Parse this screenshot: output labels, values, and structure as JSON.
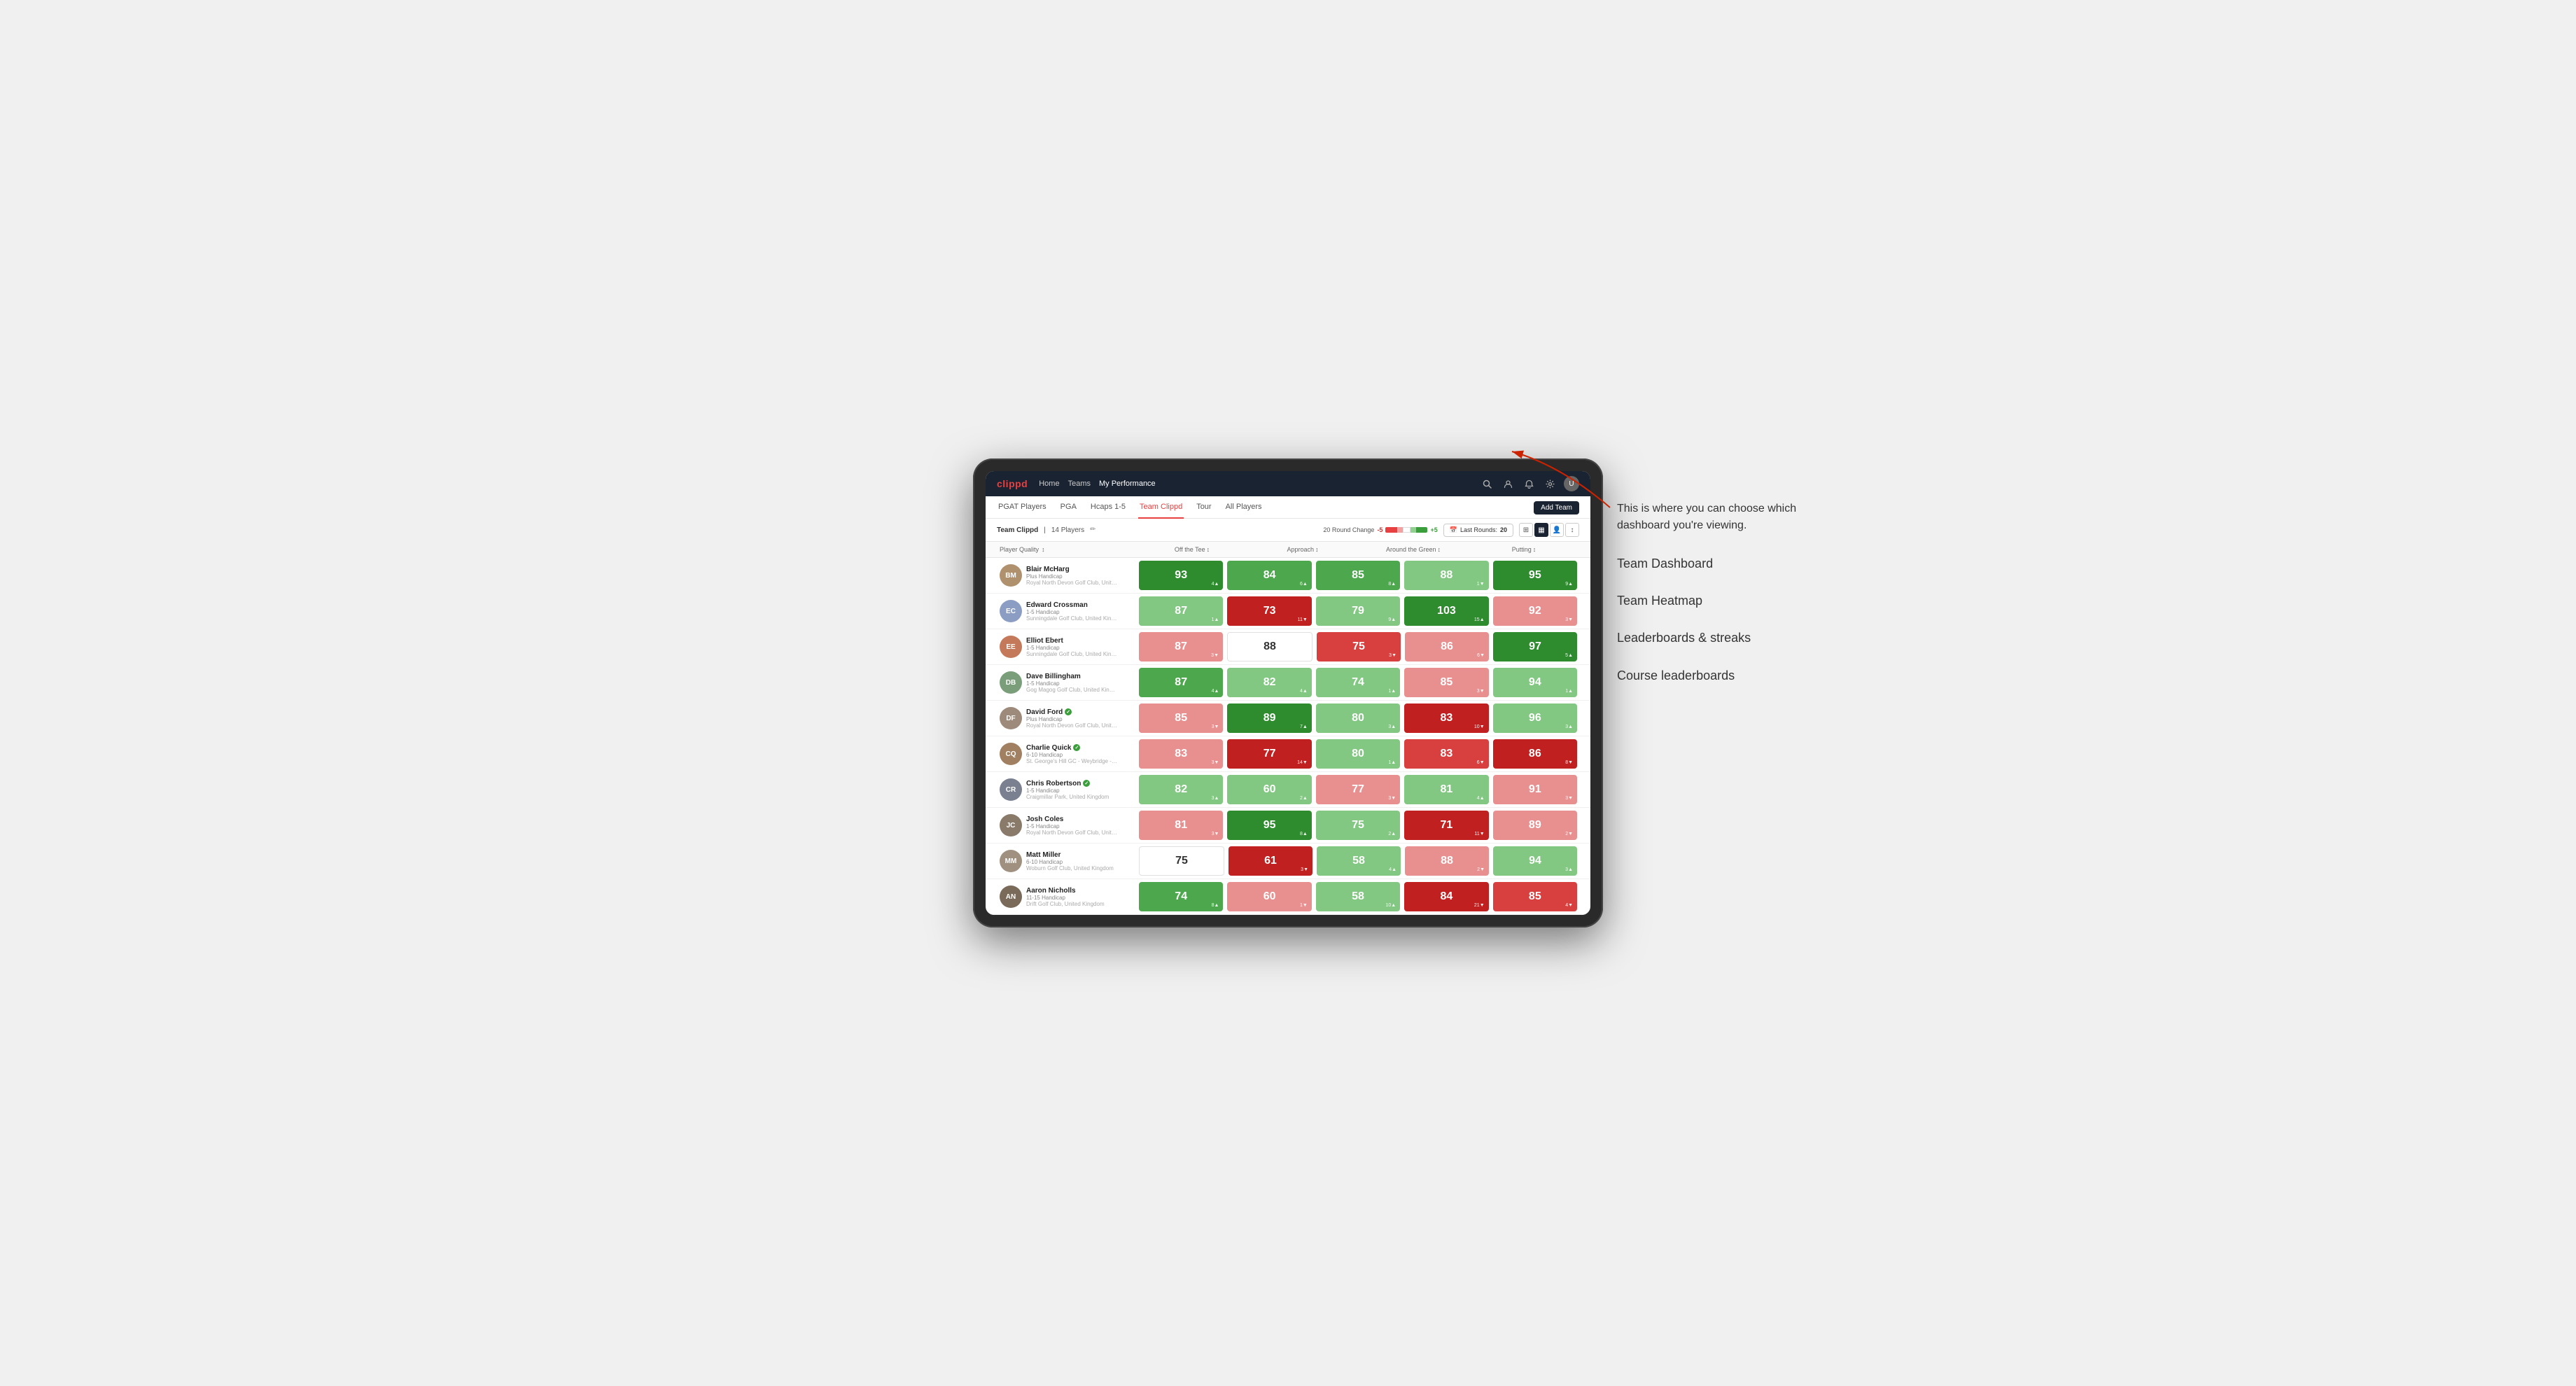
{
  "brand": "clippd",
  "navbar": {
    "links": [
      {
        "label": "Home",
        "active": false
      },
      {
        "label": "Teams",
        "active": false
      },
      {
        "label": "My Performance",
        "active": true
      }
    ],
    "icons": [
      "search",
      "person",
      "bell",
      "settings",
      "user-avatar"
    ]
  },
  "subnav": {
    "tabs": [
      {
        "label": "PGAT Players",
        "active": false
      },
      {
        "label": "PGA",
        "active": false
      },
      {
        "label": "Hcaps 1-5",
        "active": false
      },
      {
        "label": "Team Clippd",
        "active": true
      },
      {
        "label": "Tour",
        "active": false
      },
      {
        "label": "All Players",
        "active": false
      }
    ],
    "add_team_label": "Add Team"
  },
  "team_header": {
    "name": "Team Clippd",
    "separator": "|",
    "count": "14 Players",
    "round_change_label": "20 Round Change",
    "range_min": "-5",
    "range_max": "+5",
    "last_rounds_label": "Last Rounds:",
    "last_rounds_value": "20"
  },
  "table": {
    "columns": [
      {
        "label": "Player Quality",
        "key": "quality",
        "sortable": true
      },
      {
        "label": "Off the Tee",
        "key": "tee",
        "sortable": true
      },
      {
        "label": "Approach",
        "key": "approach",
        "sortable": true
      },
      {
        "label": "Around the Green",
        "key": "around",
        "sortable": true
      },
      {
        "label": "Putting",
        "key": "putting",
        "sortable": true
      }
    ],
    "rows": [
      {
        "name": "Blair McHarg",
        "handicap": "Plus Handicap",
        "club": "Royal North Devon Golf Club, United Kingdom",
        "avatar_color": "avatar-1",
        "initials": "BM",
        "quality": {
          "value": 93,
          "change": 4,
          "dir": "up",
          "color": "green-dark"
        },
        "tee": {
          "value": 84,
          "change": 6,
          "dir": "up",
          "color": "green-med"
        },
        "approach": {
          "value": 85,
          "change": 8,
          "dir": "up",
          "color": "green-med"
        },
        "around": {
          "value": 88,
          "change": 1,
          "dir": "down",
          "color": "green-light"
        },
        "putting": {
          "value": 95,
          "change": 9,
          "dir": "up",
          "color": "green-dark"
        }
      },
      {
        "name": "Edward Crossman",
        "handicap": "1-5 Handicap",
        "club": "Sunningdale Golf Club, United Kingdom",
        "avatar_color": "avatar-2",
        "initials": "EC",
        "quality": {
          "value": 87,
          "change": 1,
          "dir": "up",
          "color": "green-light"
        },
        "tee": {
          "value": 73,
          "change": 11,
          "dir": "down",
          "color": "red-dark"
        },
        "approach": {
          "value": 79,
          "change": 9,
          "dir": "up",
          "color": "green-light"
        },
        "around": {
          "value": 103,
          "change": 15,
          "dir": "up",
          "color": "green-dark"
        },
        "putting": {
          "value": 92,
          "change": 3,
          "dir": "down",
          "color": "red-light"
        }
      },
      {
        "name": "Elliot Ebert",
        "handicap": "1-5 Handicap",
        "club": "Sunningdale Golf Club, United Kingdom",
        "avatar_color": "avatar-3",
        "initials": "EE",
        "quality": {
          "value": 87,
          "change": 3,
          "dir": "down",
          "color": "red-light"
        },
        "tee": {
          "value": 88,
          "change": null,
          "dir": null,
          "color": "neutral"
        },
        "approach": {
          "value": 75,
          "change": 3,
          "dir": "down",
          "color": "red-med"
        },
        "around": {
          "value": 86,
          "change": 6,
          "dir": "down",
          "color": "red-light"
        },
        "putting": {
          "value": 97,
          "change": 5,
          "dir": "up",
          "color": "green-dark"
        }
      },
      {
        "name": "Dave Billingham",
        "handicap": "1-5 Handicap",
        "club": "Gog Magog Golf Club, United Kingdom",
        "avatar_color": "avatar-4",
        "initials": "DB",
        "quality": {
          "value": 87,
          "change": 4,
          "dir": "up",
          "color": "green-med"
        },
        "tee": {
          "value": 82,
          "change": 4,
          "dir": "up",
          "color": "green-light"
        },
        "approach": {
          "value": 74,
          "change": 1,
          "dir": "up",
          "color": "green-light"
        },
        "around": {
          "value": 85,
          "change": 3,
          "dir": "down",
          "color": "red-light"
        },
        "putting": {
          "value": 94,
          "change": 1,
          "dir": "up",
          "color": "green-light"
        }
      },
      {
        "name": "David Ford",
        "handicap": "Plus Handicap",
        "club": "Royal North Devon Golf Club, United Kingdom",
        "avatar_color": "avatar-5",
        "initials": "DF",
        "verified": true,
        "quality": {
          "value": 85,
          "change": 3,
          "dir": "down",
          "color": "red-light"
        },
        "tee": {
          "value": 89,
          "change": 7,
          "dir": "up",
          "color": "green-dark"
        },
        "approach": {
          "value": 80,
          "change": 3,
          "dir": "up",
          "color": "green-light"
        },
        "around": {
          "value": 83,
          "change": 10,
          "dir": "down",
          "color": "red-dark"
        },
        "putting": {
          "value": 96,
          "change": 3,
          "dir": "up",
          "color": "green-light"
        }
      },
      {
        "name": "Charlie Quick",
        "handicap": "6-10 Handicap",
        "club": "St. George's Hill GC - Weybridge - Surrey, Uni...",
        "avatar_color": "avatar-6",
        "initials": "CQ",
        "verified": true,
        "quality": {
          "value": 83,
          "change": 3,
          "dir": "down",
          "color": "red-light"
        },
        "tee": {
          "value": 77,
          "change": 14,
          "dir": "down",
          "color": "red-dark"
        },
        "approach": {
          "value": 80,
          "change": 1,
          "dir": "up",
          "color": "green-light"
        },
        "around": {
          "value": 83,
          "change": 6,
          "dir": "down",
          "color": "red-med"
        },
        "putting": {
          "value": 86,
          "change": 8,
          "dir": "down",
          "color": "red-dark"
        }
      },
      {
        "name": "Chris Robertson",
        "handicap": "1-5 Handicap",
        "club": "Craigmillar Park, United Kingdom",
        "avatar_color": "avatar-7",
        "initials": "CR",
        "verified": true,
        "quality": {
          "value": 82,
          "change": 3,
          "dir": "up",
          "color": "green-light"
        },
        "tee": {
          "value": 60,
          "change": 2,
          "dir": "up",
          "color": "green-light"
        },
        "approach": {
          "value": 77,
          "change": 3,
          "dir": "down",
          "color": "red-light"
        },
        "around": {
          "value": 81,
          "change": 4,
          "dir": "up",
          "color": "green-light"
        },
        "putting": {
          "value": 91,
          "change": 3,
          "dir": "down",
          "color": "red-light"
        }
      },
      {
        "name": "Josh Coles",
        "handicap": "1-5 Handicap",
        "club": "Royal North Devon Golf Club, United Kingdom",
        "avatar_color": "avatar-8",
        "initials": "JC",
        "quality": {
          "value": 81,
          "change": 3,
          "dir": "down",
          "color": "red-light"
        },
        "tee": {
          "value": 95,
          "change": 8,
          "dir": "up",
          "color": "green-dark"
        },
        "approach": {
          "value": 75,
          "change": 2,
          "dir": "up",
          "color": "green-light"
        },
        "around": {
          "value": 71,
          "change": 11,
          "dir": "down",
          "color": "red-dark"
        },
        "putting": {
          "value": 89,
          "change": 2,
          "dir": "down",
          "color": "red-light"
        }
      },
      {
        "name": "Matt Miller",
        "handicap": "6-10 Handicap",
        "club": "Woburn Golf Club, United Kingdom",
        "avatar_color": "avatar-9",
        "initials": "MM",
        "quality": {
          "value": 75,
          "change": null,
          "dir": null,
          "color": "neutral"
        },
        "tee": {
          "value": 61,
          "change": 3,
          "dir": "down",
          "color": "red-dark"
        },
        "approach": {
          "value": 58,
          "change": 4,
          "dir": "up",
          "color": "green-light"
        },
        "around": {
          "value": 88,
          "change": 2,
          "dir": "down",
          "color": "red-light"
        },
        "putting": {
          "value": 94,
          "change": 3,
          "dir": "up",
          "color": "green-light"
        }
      },
      {
        "name": "Aaron Nicholls",
        "handicap": "11-15 Handicap",
        "club": "Drift Golf Club, United Kingdom",
        "avatar_color": "avatar-10",
        "initials": "AN",
        "quality": {
          "value": 74,
          "change": 8,
          "dir": "up",
          "color": "green-med"
        },
        "tee": {
          "value": 60,
          "change": 1,
          "dir": "down",
          "color": "red-light"
        },
        "approach": {
          "value": 58,
          "change": 10,
          "dir": "up",
          "color": "green-light"
        },
        "around": {
          "value": 84,
          "change": 21,
          "dir": "down",
          "color": "red-dark"
        },
        "putting": {
          "value": 85,
          "change": 4,
          "dir": "down",
          "color": "red-med"
        }
      }
    ]
  },
  "annotations": {
    "intro": "This is where you can choose which dashboard you're viewing.",
    "items": [
      "Team Dashboard",
      "Team Heatmap",
      "Leaderboards & streaks",
      "Course leaderboards"
    ]
  }
}
